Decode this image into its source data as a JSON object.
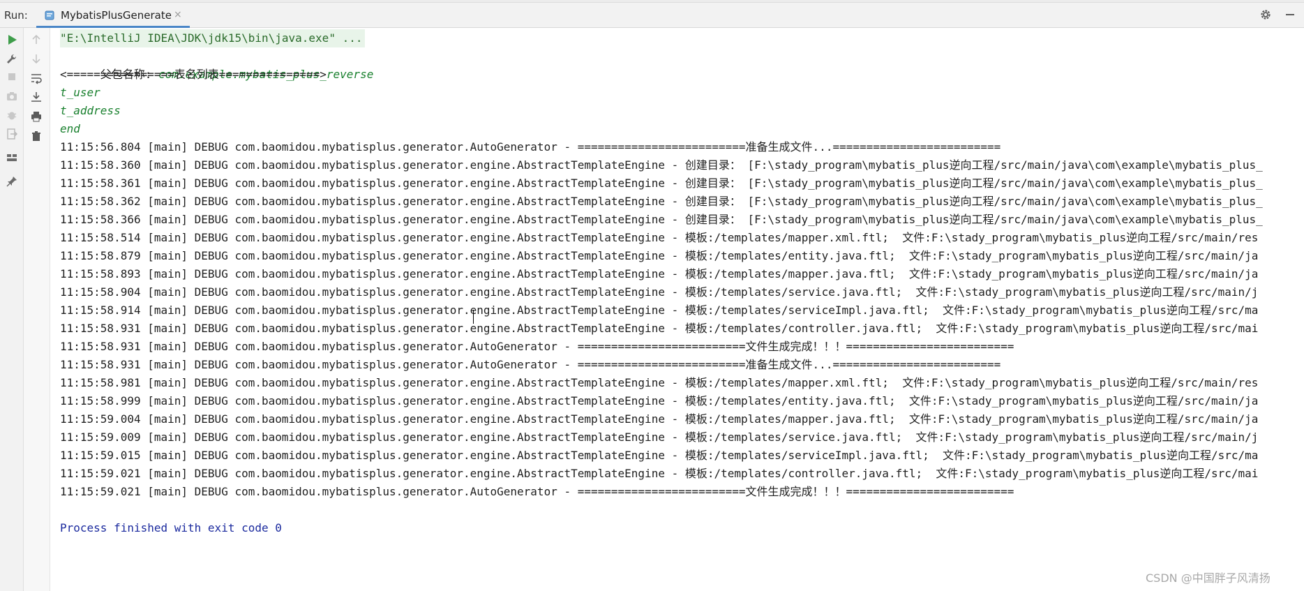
{
  "header": {
    "run_label": "Run:",
    "tab_title": "MybatisPlusGenerate",
    "tab_close": "×",
    "accent": "#4a86c7"
  },
  "toolbar": {
    "left_icons": [
      "run-icon",
      "wrench-icon",
      "stop-icon",
      "camera-icon",
      "exit-icon",
      "layout-icon",
      "pin-icon"
    ],
    "right_icons": [
      "up-arrow-icon",
      "down-arrow-icon",
      "soft-wrap-icon",
      "scroll-to-end-icon",
      "print-icon",
      "trash-icon"
    ]
  },
  "console": {
    "command": "\"E:\\IntelliJ IDEA\\JDK\\jdk15\\bin\\java.exe\" ...",
    "package_label": "父包名称: ",
    "package_value": "com.example.mybatis_plus_reverse",
    "table_list_header": "<================表名列表===============>",
    "tables": [
      "t_user",
      "t_address",
      "end"
    ],
    "log_lines": [
      "11:15:56.804 [main] DEBUG com.baomidou.mybatisplus.generator.AutoGenerator - =========================准备生成文件...=========================",
      "11:15:58.360 [main] DEBUG com.baomidou.mybatisplus.generator.engine.AbstractTemplateEngine - 创建目录： [F:\\stady_program\\mybatis_plus逆向工程/src/main/java\\com\\example\\mybatis_plus_",
      "11:15:58.361 [main] DEBUG com.baomidou.mybatisplus.generator.engine.AbstractTemplateEngine - 创建目录： [F:\\stady_program\\mybatis_plus逆向工程/src/main/java\\com\\example\\mybatis_plus_",
      "11:15:58.362 [main] DEBUG com.baomidou.mybatisplus.generator.engine.AbstractTemplateEngine - 创建目录： [F:\\stady_program\\mybatis_plus逆向工程/src/main/java\\com\\example\\mybatis_plus_",
      "11:15:58.366 [main] DEBUG com.baomidou.mybatisplus.generator.engine.AbstractTemplateEngine - 创建目录： [F:\\stady_program\\mybatis_plus逆向工程/src/main/java\\com\\example\\mybatis_plus_",
      "11:15:58.514 [main] DEBUG com.baomidou.mybatisplus.generator.engine.AbstractTemplateEngine - 模板:/templates/mapper.xml.ftl;  文件:F:\\stady_program\\mybatis_plus逆向工程/src/main/res",
      "11:15:58.879 [main] DEBUG com.baomidou.mybatisplus.generator.engine.AbstractTemplateEngine - 模板:/templates/entity.java.ftl;  文件:F:\\stady_program\\mybatis_plus逆向工程/src/main/ja",
      "11:15:58.893 [main] DEBUG com.baomidou.mybatisplus.generator.engine.AbstractTemplateEngine - 模板:/templates/mapper.java.ftl;  文件:F:\\stady_program\\mybatis_plus逆向工程/src/main/ja",
      "11:15:58.904 [main] DEBUG com.baomidou.mybatisplus.generator.engine.AbstractTemplateEngine - 模板:/templates/service.java.ftl;  文件:F:\\stady_program\\mybatis_plus逆向工程/src/main/j",
      "11:15:58.914 [main] DEBUG com.baomidou.mybatisplus.generator.engine.AbstractTemplateEngine - 模板:/templates/serviceImpl.java.ftl;  文件:F:\\stady_program\\mybatis_plus逆向工程/src/ma",
      "11:15:58.931 [main] DEBUG com.baomidou.mybatisplus.generator.engine.AbstractTemplateEngine - 模板:/templates/controller.java.ftl;  文件:F:\\stady_program\\mybatis_plus逆向工程/src/mai",
      "11:15:58.931 [main] DEBUG com.baomidou.mybatisplus.generator.AutoGenerator - =========================文件生成完成！！！=========================",
      "11:15:58.931 [main] DEBUG com.baomidou.mybatisplus.generator.AutoGenerator - =========================准备生成文件...=========================",
      "11:15:58.981 [main] DEBUG com.baomidou.mybatisplus.generator.engine.AbstractTemplateEngine - 模板:/templates/mapper.xml.ftl;  文件:F:\\stady_program\\mybatis_plus逆向工程/src/main/res",
      "11:15:58.999 [main] DEBUG com.baomidou.mybatisplus.generator.engine.AbstractTemplateEngine - 模板:/templates/entity.java.ftl;  文件:F:\\stady_program\\mybatis_plus逆向工程/src/main/ja",
      "11:15:59.004 [main] DEBUG com.baomidou.mybatisplus.generator.engine.AbstractTemplateEngine - 模板:/templates/mapper.java.ftl;  文件:F:\\stady_program\\mybatis_plus逆向工程/src/main/ja",
      "11:15:59.009 [main] DEBUG com.baomidou.mybatisplus.generator.engine.AbstractTemplateEngine - 模板:/templates/service.java.ftl;  文件:F:\\stady_program\\mybatis_plus逆向工程/src/main/j",
      "11:15:59.015 [main] DEBUG com.baomidou.mybatisplus.generator.engine.AbstractTemplateEngine - 模板:/templates/serviceImpl.java.ftl;  文件:F:\\stady_program\\mybatis_plus逆向工程/src/ma",
      "11:15:59.021 [main] DEBUG com.baomidou.mybatisplus.generator.engine.AbstractTemplateEngine - 模板:/templates/controller.java.ftl;  文件:F:\\stady_program\\mybatis_plus逆向工程/src/mai",
      "11:15:59.021 [main] DEBUG com.baomidou.mybatisplus.generator.AutoGenerator - =========================文件生成完成！！！========================="
    ],
    "process_finished": "Process finished with exit code 0"
  },
  "watermark": "CSDN @中国胖子风清扬"
}
